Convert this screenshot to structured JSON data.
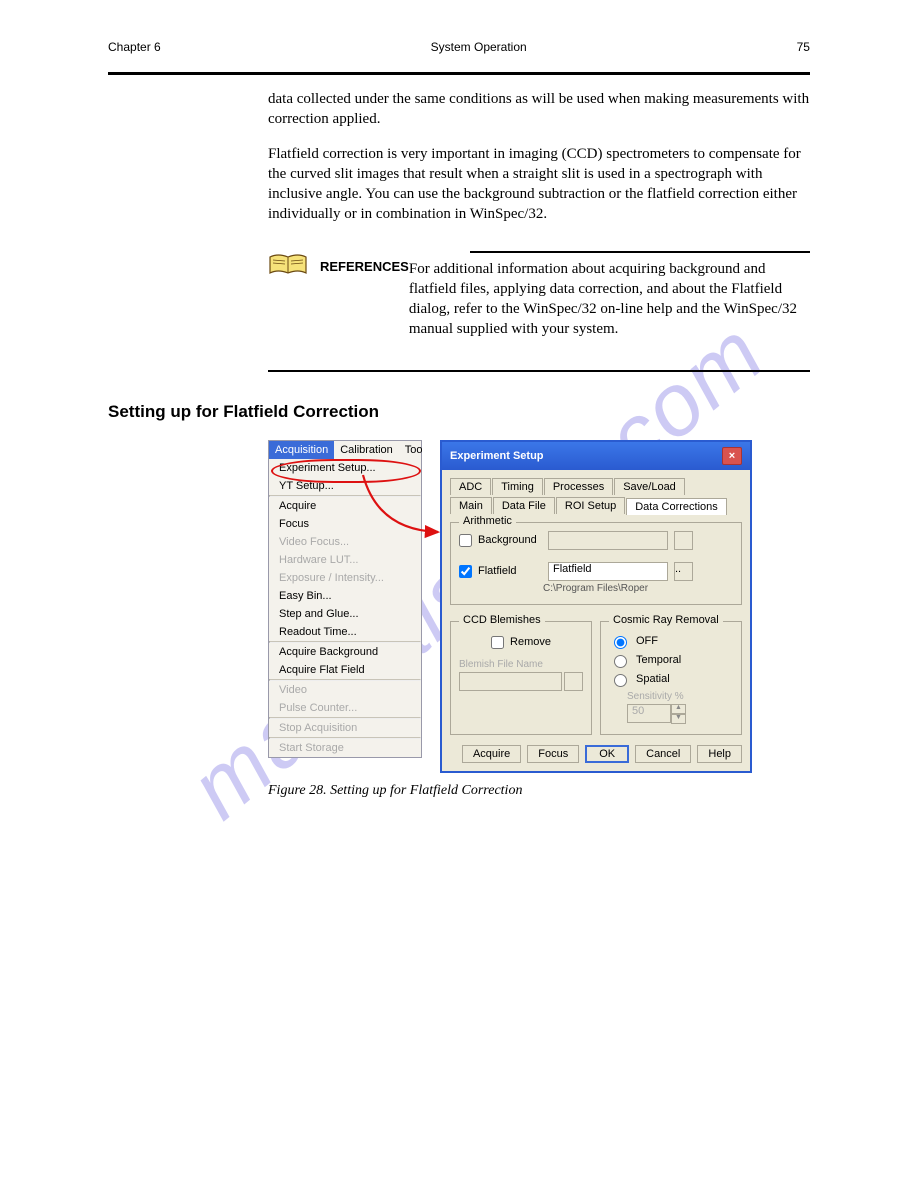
{
  "header": {
    "left": "Chapter 6",
    "center": "System Operation",
    "right": "75"
  },
  "paragraphs": {
    "p1": "data collected under the same conditions as will be used when making measurements with correction applied.",
    "p2": "Flatfield correction is very important in imaging (CCD) spectrometers to compensate for the curved slit images that result when a straight slit is used in a spectrograph with inclusive angle. You can use the background subtraction or the flatfield correction either individually or in combination in WinSpec/32."
  },
  "note": {
    "title": "REFERENCES",
    "body": "For additional information about acquiring background and flatfield files, applying data correction, and about the Flatfield dialog, refer to the WinSpec/32 on-line help and the WinSpec/32 manual supplied with your system."
  },
  "heading": "Setting up for Flatfield Correction",
  "menu": {
    "tabs": {
      "sel": "Acquisition",
      "t2": "Calibration",
      "t3": "Too"
    },
    "items": [
      {
        "label": "Experiment Setup...",
        "dis": false
      },
      {
        "label": "YT Setup...",
        "dis": false
      },
      {
        "label": "Acquire",
        "dis": false
      },
      {
        "label": "Focus",
        "dis": false
      },
      {
        "label": "Video Focus...",
        "dis": true
      },
      {
        "label": "Hardware LUT...",
        "dis": true
      },
      {
        "label": "Exposure / Intensity...",
        "dis": true
      },
      {
        "label": "Easy Bin...",
        "dis": false
      },
      {
        "label": "Step and Glue...",
        "dis": false
      },
      {
        "label": "Readout Time...",
        "dis": false
      },
      {
        "label": "Acquire Background",
        "dis": false
      },
      {
        "label": "Acquire Flat Field",
        "dis": false
      },
      {
        "label": "Video",
        "dis": true
      },
      {
        "label": "Pulse Counter...",
        "dis": true
      },
      {
        "label": "Stop Acquisition",
        "dis": true
      },
      {
        "label": "Start Storage",
        "dis": true
      }
    ]
  },
  "dlg": {
    "title": "Experiment Setup",
    "tabs_row1": [
      "ADC",
      "Timing",
      "Processes",
      "Save/Load"
    ],
    "tabs_row2": [
      "Main",
      "Data File",
      "ROI Setup",
      "Data Corrections"
    ],
    "arithmetic": {
      "title": "Arithmetic",
      "background": {
        "label": "Background",
        "checked": false
      },
      "flatfield": {
        "label": "Flatfield",
        "checked": true,
        "value": "Flatfield",
        "path": "C:\\Program Files\\Roper"
      }
    },
    "blemishes": {
      "title": "CCD Blemishes",
      "remove": {
        "label": "Remove",
        "checked": false
      },
      "filename_label": "Blemish File Name"
    },
    "cosmic": {
      "title": "Cosmic Ray Removal",
      "options": {
        "off": "OFF",
        "temporal": "Temporal",
        "spatial": "Spatial"
      },
      "sens_label": "Sensitivity %",
      "sens_value": "50"
    },
    "buttons": {
      "acquire": "Acquire",
      "focus": "Focus",
      "ok": "OK",
      "cancel": "Cancel",
      "help": "Help"
    }
  },
  "figcap": "Figure 28. Setting up for Flatfield Correction",
  "watermark": "manualshive.com"
}
